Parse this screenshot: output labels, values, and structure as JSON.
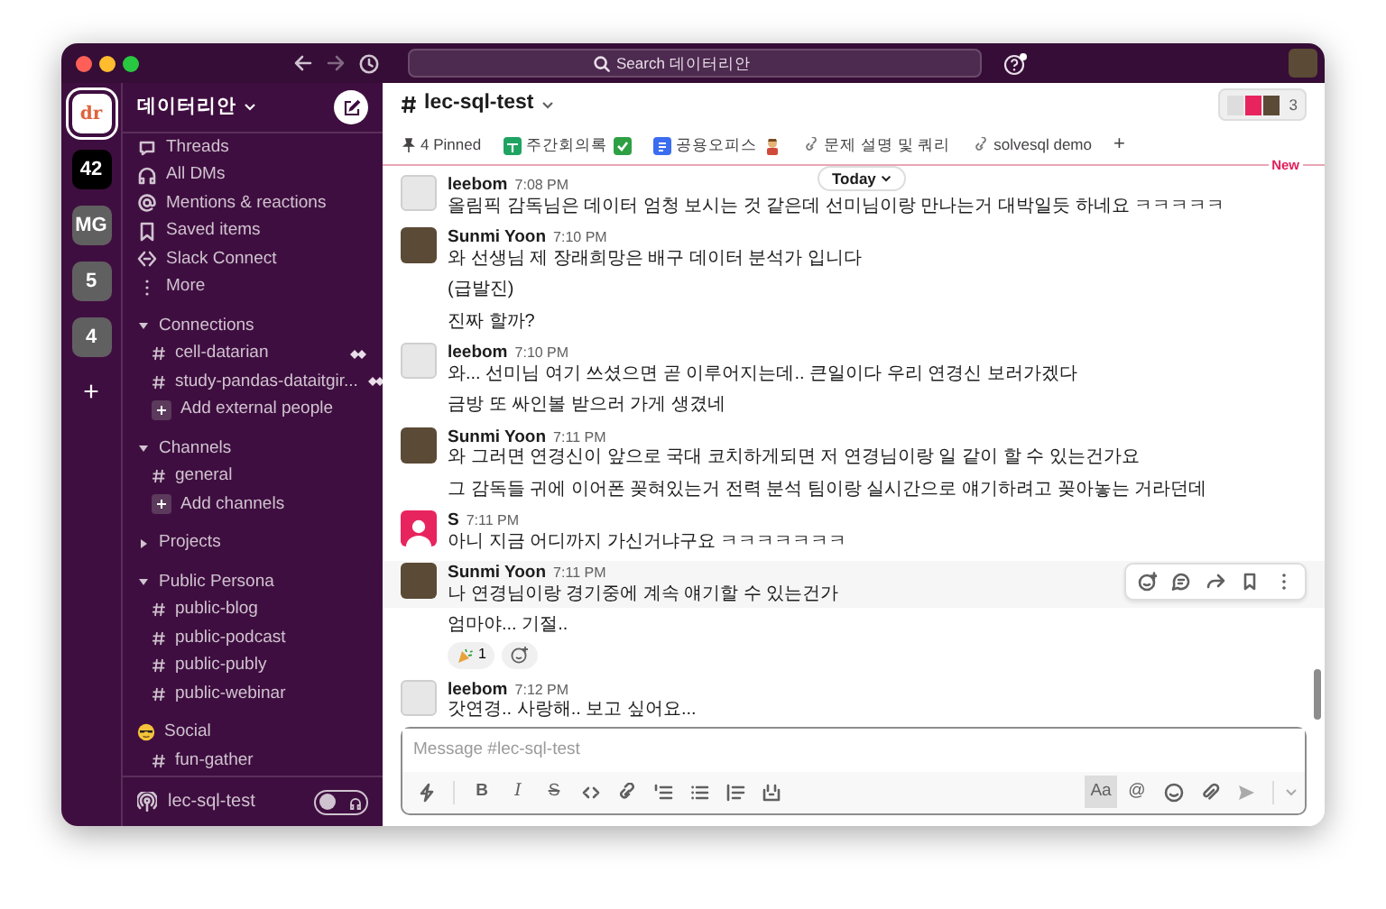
{
  "titlebar": {
    "search_placeholder": "Search 데이터리안"
  },
  "workspaces": [
    {
      "kind": "logo",
      "label": "dr",
      "selected": true
    },
    {
      "kind": "text",
      "label": "42",
      "selected": false
    },
    {
      "kind": "text",
      "label": "MG",
      "selected": false
    },
    {
      "kind": "text",
      "label": "5",
      "selected": false
    },
    {
      "kind": "text",
      "label": "4",
      "selected": false
    },
    {
      "kind": "add",
      "label": "+",
      "selected": false
    }
  ],
  "sidebar": {
    "workspace_name": "데이터리안",
    "nav": [
      {
        "kind": "threads",
        "label": "Threads"
      },
      {
        "kind": "dms",
        "label": "All DMs"
      },
      {
        "kind": "mentions",
        "label": "Mentions & reactions"
      },
      {
        "kind": "saved",
        "label": "Saved items"
      },
      {
        "kind": "connect",
        "label": "Slack Connect"
      },
      {
        "kind": "more",
        "label": "More"
      }
    ],
    "sections": [
      {
        "title": "Connections",
        "kind": "caret",
        "expanded": true,
        "items": [
          {
            "kind": "channel",
            "label": "cell-datarian",
            "shared": true
          },
          {
            "kind": "channel",
            "label": "study-pandas-dataitgir...",
            "shared": true
          },
          {
            "kind": "add",
            "label": "Add external people"
          }
        ]
      },
      {
        "title": "Channels",
        "kind": "caret",
        "expanded": true,
        "items": [
          {
            "kind": "channel",
            "label": "general",
            "shared": false
          },
          {
            "kind": "add",
            "label": "Add channels"
          }
        ]
      },
      {
        "title": "Projects",
        "kind": "caret",
        "expanded": false
      },
      {
        "title": "Public Persona",
        "kind": "caret",
        "expanded": true,
        "items": [
          {
            "kind": "channel",
            "label": "public-blog",
            "shared": false
          },
          {
            "kind": "channel",
            "label": "public-podcast",
            "shared": false
          },
          {
            "kind": "channel",
            "label": "public-publy",
            "shared": false
          },
          {
            "kind": "channel",
            "label": "public-webinar",
            "shared": false
          }
        ]
      },
      {
        "title": "Social",
        "kind": "emoji",
        "expanded": true,
        "items": [
          {
            "kind": "channel",
            "label": "fun-gather",
            "shared": false
          }
        ]
      }
    ],
    "footer": {
      "huddle": "lec-sql-test",
      "toggle_on": false
    }
  },
  "channel": {
    "name": "lec-sql-test",
    "member_count": "3",
    "bookmarks": [
      {
        "kind": "pinned",
        "label": "4 Pinned"
      },
      {
        "kind": "sheet",
        "label": "주간회의록"
      },
      {
        "kind": "doc",
        "label": "공용오피스"
      },
      {
        "kind": "link",
        "label": "문제 설명 및 쿼리"
      },
      {
        "kind": "link",
        "label": "solvesql demo"
      },
      {
        "kind": "add",
        "label": "+"
      }
    ]
  },
  "divider": {
    "label": "Today",
    "new_label": "New"
  },
  "messages": [
    {
      "author": "leebom",
      "time": "7:08 PM",
      "avatar": {
        "kind": "drawing"
      },
      "lines": [
        {
          "text": "올림픽 감독님은 데이터 엄청 보시는 것 같은데 선미님이랑 만나는거 대박일듯 하네요 ㅋㅋㅋㅋㅋ",
          "highlighted": false
        }
      ]
    },
    {
      "author": "Sunmi Yoon",
      "time": "7:10 PM",
      "avatar": {
        "kind": "photo"
      },
      "lines": [
        {
          "text": "와 선생님 제 장래희망은 배구 데이터 분석가 입니다",
          "highlighted": false
        },
        {
          "text": "(급발진)",
          "highlighted": false
        },
        {
          "text": "진짜 할까?",
          "highlighted": false
        }
      ]
    },
    {
      "author": "leebom",
      "time": "7:10 PM",
      "avatar": {
        "kind": "drawing"
      },
      "lines": [
        {
          "text": "와... 선미님 여기 쓰셨으면 곧 이루어지는데.. 큰일이다 우리 연경신 보러가겠다",
          "highlighted": false
        },
        {
          "text": "금방 또 싸인볼 받으러 가게 생겼네",
          "highlighted": false
        }
      ]
    },
    {
      "author": "Sunmi Yoon",
      "time": "7:11 PM",
      "avatar": {
        "kind": "photo"
      },
      "lines": [
        {
          "text": "와 그러면 연경신이 앞으로 국대 코치하게되면 저 연경님이랑 일 같이 할 수 있는건가요",
          "highlighted": false
        },
        {
          "text": "그 감독들 귀에 이어폰 꽂혀있는거 전력 분석 팀이랑 실시간으로 얘기하려고 꽂아놓는 거라던데",
          "highlighted": false
        }
      ]
    },
    {
      "author": "S",
      "time": "7:11 PM",
      "avatar": {
        "kind": "default"
      },
      "lines": [
        {
          "text": "아니 지금 어디까지 가신거냐구요 ㅋㅋㅋㅋㅋㅋㅋ",
          "highlighted": false
        }
      ]
    },
    {
      "author": "Sunmi Yoon",
      "time": "7:11 PM",
      "avatar": {
        "kind": "photo"
      },
      "lines": [
        {
          "text": "나 연경님이랑 경기중에 계속 얘기할 수 있는건가",
          "highlighted": true
        },
        {
          "text": "엄마야... 기절..",
          "highlighted": false,
          "reactions": [
            {
              "count": "1"
            }
          ]
        }
      ]
    },
    {
      "author": "leebom",
      "time": "7:12 PM",
      "avatar": {
        "kind": "drawing"
      },
      "lines": [
        {
          "text": "갓연경.. 사랑해.. 보고 싶어요...",
          "highlighted": false
        }
      ]
    }
  ],
  "composer": {
    "placeholder": "Message #lec-sql-test",
    "tools": [
      {
        "kind": "shortcut"
      },
      {
        "kind": "bold",
        "label": "B"
      },
      {
        "kind": "italic",
        "label": "I"
      },
      {
        "kind": "strike",
        "label": "S"
      },
      {
        "kind": "code"
      },
      {
        "kind": "link"
      },
      {
        "kind": "ordered"
      },
      {
        "kind": "bulleted"
      },
      {
        "kind": "quote"
      },
      {
        "kind": "codeblock"
      }
    ],
    "right_tools": [
      {
        "kind": "format",
        "label": "Aa",
        "selected": true
      },
      {
        "kind": "mention",
        "label": "@"
      },
      {
        "kind": "emoji"
      },
      {
        "kind": "attach"
      },
      {
        "kind": "send"
      }
    ]
  }
}
